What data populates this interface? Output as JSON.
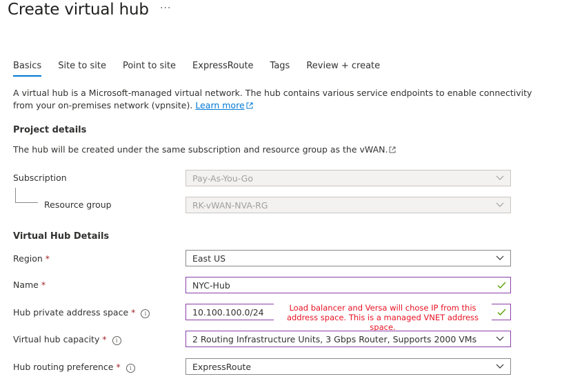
{
  "header": {
    "title": "Create virtual hub",
    "more": "···"
  },
  "tabs": [
    "Basics",
    "Site to site",
    "Point to site",
    "ExpressRoute",
    "Tags",
    "Review + create"
  ],
  "description": {
    "text": "A virtual hub is a Microsoft-managed virtual network. The hub contains various service endpoints to enable connectivity from your on-premises network (vpnsite).",
    "link": "Learn more"
  },
  "project": {
    "heading": "Project details",
    "subtext": "The hub will be created under the same subscription and resource group as the vWAN.",
    "subscription": {
      "label": "Subscription",
      "value": "Pay-As-You-Go"
    },
    "resource_group": {
      "label": "Resource group",
      "value": "RK-vWAN-NVA-RG"
    }
  },
  "hub": {
    "heading": "Virtual Hub Details",
    "region": {
      "label": "Region",
      "value": "East US"
    },
    "name": {
      "label": "Name",
      "value": "NYC-Hub"
    },
    "address": {
      "label": "Hub private address space",
      "value": "10.100.100.0/24"
    },
    "capacity": {
      "label": "Virtual hub capacity",
      "value": "2 Routing Infrastructure Units, 3 Gbps Router, Supports 2000 VMs"
    },
    "routing": {
      "label": "Hub routing preference",
      "value": "ExpressRoute"
    }
  },
  "annotation": "Load balancer and Versa will chose IP from this address space. This is a managed VNET address space.",
  "required_mark": "*",
  "info_glyph": "i",
  "colors": {
    "accent": "#0078d4",
    "required": "#a4262c",
    "annotation": "#e81123",
    "valid_check": "#57a300"
  }
}
